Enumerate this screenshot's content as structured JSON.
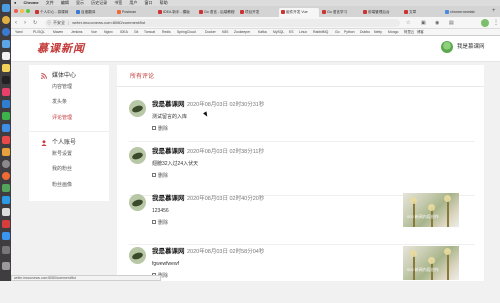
{
  "os_menubar": {
    "app_name": "Chrome",
    "items": [
      "文件",
      "编辑",
      "显示",
      "历史记录",
      "书签",
      "用户",
      "窗口",
      "帮助"
    ]
  },
  "browser": {
    "tabs": [
      {
        "label": "个人中心 - 慕课网",
        "active": false
      },
      {
        "label": "百度翻译",
        "active": false
      },
      {
        "label": "Postman",
        "active": false
      },
      {
        "label": "IDEA 新手 - 模版",
        "active": false
      },
      {
        "label": "Go 语言 - 后端教程",
        "active": false
      },
      {
        "label": "项目开发",
        "active": false
      },
      {
        "label": "组件开发 Vue",
        "active": true
      },
      {
        "label": "Go 语言学习",
        "active": false
      },
      {
        "label": "前端管理后台",
        "active": false
      },
      {
        "label": "文章",
        "active": false
      },
      {
        "label": "chrome:newtab",
        "active": false
      }
    ],
    "url_security": "不安全",
    "url": "writer.imoocnews.com:8080/comment/list",
    "bookmarks": [
      "Yaml",
      "PL/SQL",
      "Maven",
      "Jenkins",
      "Vue",
      "Nginx",
      "IDEA",
      "Git",
      "Tomcat",
      "Redis",
      "SpringCloud",
      "Docker",
      "K8S",
      "Zookeeper",
      "Kafka",
      "MySQL",
      "ES",
      "Linux",
      "RabbitMQ",
      "Go",
      "Python",
      "Dubbo",
      "Netty",
      "Mongo",
      "阿里云",
      "博客"
    ],
    "status_url": "writer.imoocnews.com:8080/comment/list"
  },
  "header": {
    "logo_text": "慕课新闻",
    "username": "我是慕课网"
  },
  "sidebar": {
    "sections": [
      {
        "title": "媒体中心",
        "items": [
          {
            "label": "内容管理",
            "active": false
          },
          {
            "label": "发头条",
            "active": false
          },
          {
            "label": "评论管理",
            "active": true
          }
        ]
      },
      {
        "title": "个人账号",
        "items": [
          {
            "label": "账号设置",
            "active": false
          },
          {
            "label": "我的粉丝",
            "active": false
          },
          {
            "label": "粉丝画像",
            "active": false
          }
        ]
      }
    ]
  },
  "main": {
    "title": "所有评论",
    "delete_label": "删除",
    "comments": [
      {
        "user": "我是慕课网",
        "time": "2020年08月03日 02时30分31秒",
        "text": "测试留言的入库",
        "article_caption": ""
      },
      {
        "user": "我是慕课网",
        "time": "2020年08月03日 02时38分11秒",
        "text": "翅膀32入过24入伏天",
        "article_caption": ""
      },
      {
        "user": "我是慕课网",
        "time": "2020年08月03日 02时40分20秒",
        "text": "123456",
        "article_caption": "002 新闻内容创作"
      },
      {
        "user": "我是慕课网",
        "time": "2020年08月03日 02时58分04秒",
        "text": "fgwewfwewf",
        "article_caption": "002 新闻内容创作"
      }
    ]
  },
  "colors": {
    "accent": "#c33a3a",
    "page_bg": "#f1f1f1",
    "panel_bg": "#ffffff",
    "dock_bg": "#3f3d40"
  }
}
